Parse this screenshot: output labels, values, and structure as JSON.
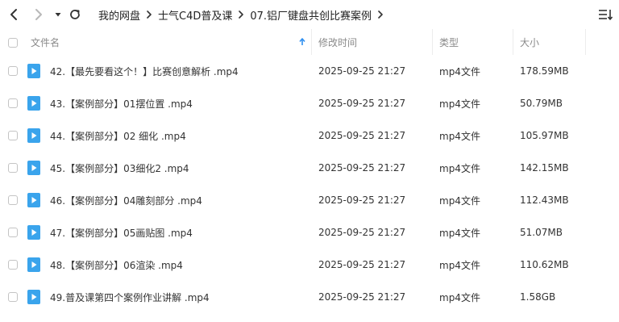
{
  "toolbar": {
    "back_icon": "back-arrow-icon",
    "forward_icon": "forward-arrow-icon",
    "dropdown_icon": "dropdown-caret-icon",
    "refresh_icon": "refresh-icon",
    "view_toggle_icon": "sort-list-icon",
    "breadcrumb": [
      "我的网盘",
      "士气C4D普及课",
      "07.铝厂键盘共创比赛案例"
    ]
  },
  "header": {
    "name": "文件名",
    "modified": "修改时间",
    "type": "类型",
    "size": "大小",
    "sort_icon": "sort-ascending-icon"
  },
  "files": [
    {
      "name": "42.【最先要看这个！】比赛创意解析 .mp4",
      "modified": "2025-09-25 21:27",
      "type": "mp4文件",
      "size": "178.59MB"
    },
    {
      "name": "43.【案例部分】01摆位置 .mp4",
      "modified": "2025-09-25 21:27",
      "type": "mp4文件",
      "size": "50.79MB"
    },
    {
      "name": "44.【案例部分】02 细化 .mp4",
      "modified": "2025-09-25 21:27",
      "type": "mp4文件",
      "size": "105.97MB"
    },
    {
      "name": "45.【案例部分】03细化2 .mp4",
      "modified": "2025-09-25 21:27",
      "type": "mp4文件",
      "size": "142.15MB"
    },
    {
      "name": "46.【案例部分】04雕刻部分 .mp4",
      "modified": "2025-09-25 21:27",
      "type": "mp4文件",
      "size": "112.43MB"
    },
    {
      "name": "47.【案例部分】05画贴图 .mp4",
      "modified": "2025-09-25 21:27",
      "type": "mp4文件",
      "size": "51.07MB"
    },
    {
      "name": "48.【案例部分】06渲染 .mp4",
      "modified": "2025-09-25 21:27",
      "type": "mp4文件",
      "size": "110.62MB"
    },
    {
      "name": "49.普及课第四个案例作业讲解 .mp4",
      "modified": "2025-09-25 21:27",
      "type": "mp4文件",
      "size": "1.58GB"
    }
  ],
  "colors": {
    "video_icon": "#3aa4ec",
    "header_text": "#8a8a8a",
    "sort_arrow": "#2f8ff0"
  }
}
